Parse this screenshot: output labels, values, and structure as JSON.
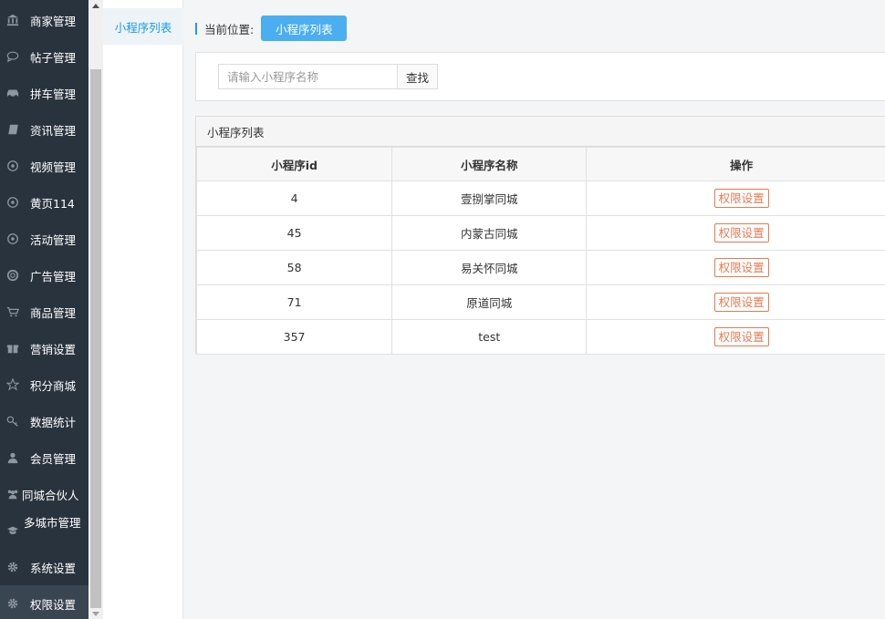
{
  "sidebar": {
    "items": [
      {
        "label": "商家管理",
        "icon": "bank-icon"
      },
      {
        "label": "帖子管理",
        "icon": "comment-icon"
      },
      {
        "label": "拼车管理",
        "icon": "car-icon"
      },
      {
        "label": "资讯管理",
        "icon": "book-icon"
      },
      {
        "label": "视频管理",
        "icon": "compass-icon"
      },
      {
        "label": "黄页114",
        "icon": "compass-icon"
      },
      {
        "label": "活动管理",
        "icon": "compass-icon"
      },
      {
        "label": "广告管理",
        "icon": "life-ring-icon"
      },
      {
        "label": "商品管理",
        "icon": "cart-icon"
      },
      {
        "label": "营销设置",
        "icon": "gift-icon"
      },
      {
        "label": "积分商城",
        "icon": "star-icon"
      },
      {
        "label": "数据统计",
        "icon": "key-icon"
      },
      {
        "label": "会员管理",
        "icon": "user-icon"
      },
      {
        "label": "同城合伙人",
        "icon": "users-icon"
      },
      {
        "label": "多城市管理",
        "icon": "graduation-cap-icon"
      },
      {
        "label": "系统设置",
        "icon": "gear-icon"
      },
      {
        "label": "权限设置",
        "icon": "gear-icon"
      }
    ]
  },
  "subnav": {
    "item": "小程序列表"
  },
  "breadcrumb": {
    "label": "当前位置:",
    "current": "小程序列表"
  },
  "search": {
    "placeholder": "请输入小程序名称",
    "button": "查找"
  },
  "list": {
    "title": "小程序列表",
    "columns": [
      "小程序id",
      "小程序名称",
      "操作"
    ],
    "rows": [
      {
        "id": "4",
        "name": "壹捌掌同城",
        "action": "权限设置"
      },
      {
        "id": "45",
        "name": "内蒙古同城",
        "action": "权限设置"
      },
      {
        "id": "58",
        "name": "易关怀同城",
        "action": "权限设置"
      },
      {
        "id": "71",
        "name": "原道同城",
        "action": "权限设置"
      },
      {
        "id": "357",
        "name": "test",
        "action": "权限设置"
      }
    ]
  },
  "colors": {
    "accent": "#1a9be6",
    "button": "#4aaef0",
    "danger": "#e57a52",
    "sidebar": "#29333d"
  }
}
